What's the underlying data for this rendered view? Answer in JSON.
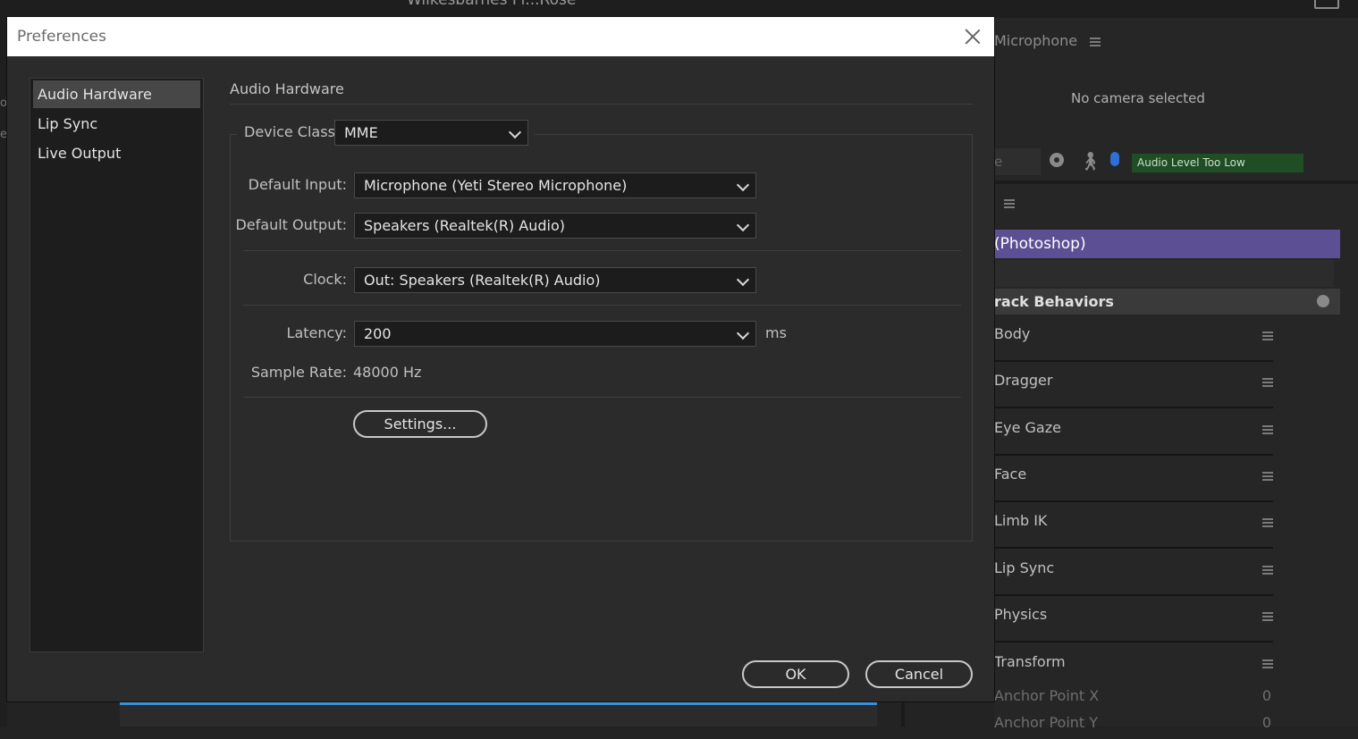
{
  "background": {
    "app_title": "Wilkesbarnes Fl...Rose",
    "left_text_a": "oe",
    "left_text_b": "er",
    "microphone_panel": {
      "header": "Microphone",
      "no_camera": "No camera selected",
      "search_partial": "e",
      "audio_level": "Audio Level Too Low"
    },
    "puppet": {
      "name": "(Photoshop)",
      "track_behaviors": "rack Behaviors",
      "behaviors": [
        "Body",
        "Dragger",
        "Eye Gaze",
        "Face",
        "Limb IK",
        "Lip Sync",
        "Physics",
        "Transform"
      ],
      "properties": [
        {
          "name": "Anchor Point X",
          "value": "0"
        },
        {
          "name": "Anchor Point Y",
          "value": "0"
        }
      ]
    }
  },
  "dialog": {
    "title": "Preferences",
    "sidebar": [
      "Audio Hardware",
      "Lip Sync",
      "Live Output"
    ],
    "selected": "Audio Hardware",
    "section_title": "Audio Hardware",
    "device_class": {
      "label": "Device Class:",
      "value": "MME"
    },
    "default_input": {
      "label": "Default Input:",
      "value": "Microphone (Yeti Stereo Microphone)"
    },
    "default_output": {
      "label": "Default Output:",
      "value": "Speakers (Realtek(R) Audio)"
    },
    "clock": {
      "label": "Clock:",
      "value": "Out: Speakers (Realtek(R) Audio)"
    },
    "latency": {
      "label": "Latency:",
      "value": "200",
      "unit": "ms"
    },
    "sample_rate": {
      "label": "Sample Rate:",
      "value": "48000 Hz"
    },
    "settings_button": "Settings...",
    "ok_button": "OK",
    "cancel_button": "Cancel"
  },
  "colors": {
    "puppet_highlight": "#5d4f94",
    "audio_level_bg": "#1f4d24",
    "mic_icon": "#2f6fd6",
    "timeline_accent": "#3a8fd8"
  }
}
